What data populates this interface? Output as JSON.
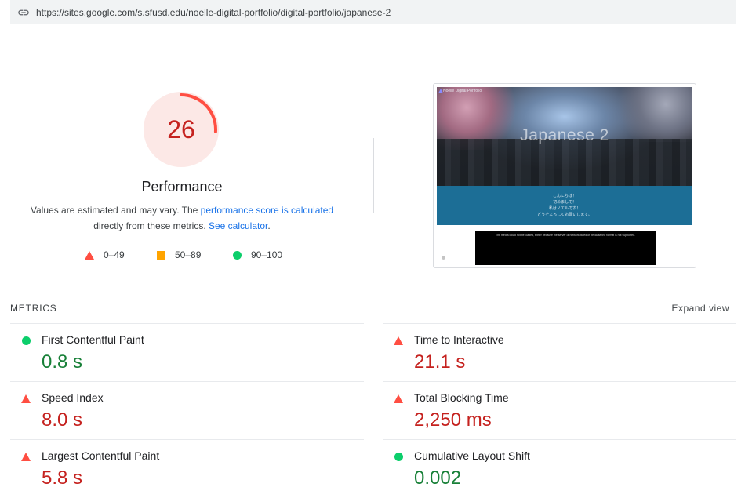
{
  "url_bar": {
    "icon": "link-icon",
    "url": "https://sites.google.com/s.sfusd.edu/noelle-digital-portfolio/digital-portfolio/japanese-2"
  },
  "score": {
    "value": "26",
    "fraction": 0.26,
    "label": "Performance",
    "color": "#ff4e42",
    "text_color": "#c5221f",
    "bg_color": "#fce8e6"
  },
  "description": {
    "part1": "Values are estimated and may vary. The ",
    "link1": "performance score is calculated",
    "part2": " directly from these metrics. ",
    "link2": "See calculator",
    "part3": "."
  },
  "legend": [
    {
      "shape": "triangle",
      "range": "0–49",
      "color": "#ff4e42"
    },
    {
      "shape": "square",
      "range": "50–89",
      "color": "#ffa400"
    },
    {
      "shape": "circle",
      "range": "90–100",
      "color": "#0cce6b"
    }
  ],
  "preview": {
    "site_name": "Noelle Digital Portfolio",
    "hero_title": "Japanese 2",
    "band_lines": [
      "こんにちは！",
      "初めまして！",
      "私はノエルです！",
      "どうぞよろしくお願いします。"
    ],
    "notice": "The media could not be loaded, either because the server or network failed or because the format is not supported."
  },
  "metrics_section": {
    "title": "METRICS",
    "expand": "Expand view"
  },
  "metrics": [
    {
      "label": "First Contentful Paint",
      "value": "0.8 s",
      "status": "good"
    },
    {
      "label": "Time to Interactive",
      "value": "21.1 s",
      "status": "poor"
    },
    {
      "label": "Speed Index",
      "value": "8.0 s",
      "status": "poor"
    },
    {
      "label": "Total Blocking Time",
      "value": "2,250 ms",
      "status": "poor"
    },
    {
      "label": "Largest Contentful Paint",
      "value": "5.8 s",
      "status": "poor"
    },
    {
      "label": "Cumulative Layout Shift",
      "value": "0.002",
      "status": "good"
    }
  ]
}
